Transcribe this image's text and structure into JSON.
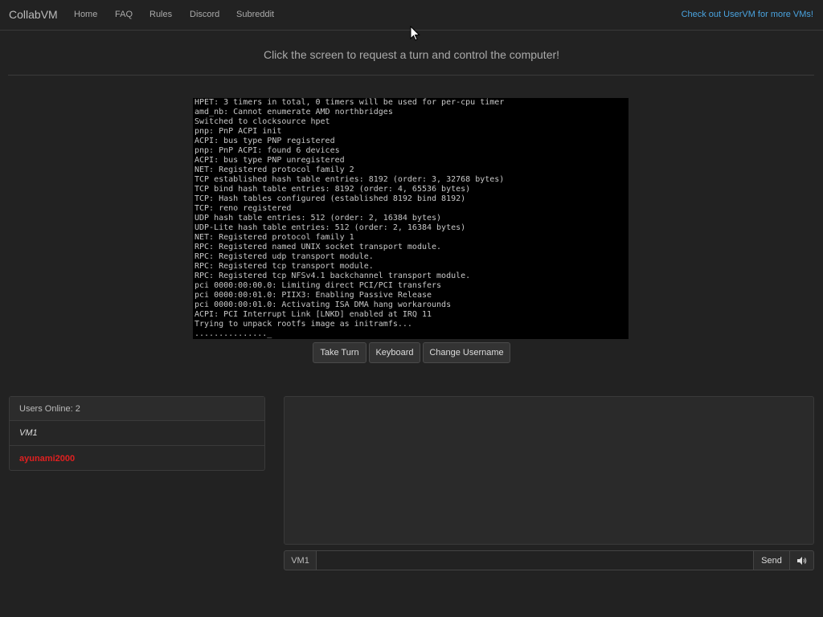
{
  "nav": {
    "brand": "CollabVM",
    "links": [
      "Home",
      "FAQ",
      "Rules",
      "Discord",
      "Subreddit"
    ],
    "promo": "Check out UserVM for more VMs!"
  },
  "prompt": "Click the screen to request a turn and control the computer!",
  "terminal": {
    "lines": [
      "HPET: 3 timers in total, 0 timers will be used for per-cpu timer",
      "amd_nb: Cannot enumerate AMD northbridges",
      "Switched to clocksource hpet",
      "pnp: PnP ACPI init",
      "ACPI: bus type PNP registered",
      "pnp: PnP ACPI: found 6 devices",
      "ACPI: bus type PNP unregistered",
      "NET: Registered protocol family 2",
      "TCP established hash table entries: 8192 (order: 3, 32768 bytes)",
      "TCP bind hash table entries: 8192 (order: 4, 65536 bytes)",
      "TCP: Hash tables configured (established 8192 bind 8192)",
      "TCP: reno registered",
      "UDP hash table entries: 512 (order: 2, 16384 bytes)",
      "UDP-Lite hash table entries: 512 (order: 2, 16384 bytes)",
      "NET: Registered protocol family 1",
      "RPC: Registered named UNIX socket transport module.",
      "RPC: Registered udp transport module.",
      "RPC: Registered tcp transport module.",
      "RPC: Registered tcp NFSv4.1 backchannel transport module.",
      "pci 0000:00:00.0: Limiting direct PCI/PCI transfers",
      "pci 0000:00:01.0: PIIX3: Enabling Passive Release",
      "pci 0000:00:01.0: Activating ISA DMA hang workarounds",
      "ACPI: PCI Interrupt Link [LNKD] enabled at IRQ 11",
      "Trying to unpack rootfs image as initramfs...",
      "..............._"
    ]
  },
  "buttons": {
    "take_turn": "Take Turn",
    "keyboard": "Keyboard",
    "change_username": "Change Username"
  },
  "users": {
    "header": "Users Online: 2",
    "list": [
      {
        "name": "VM1",
        "color": "#dddddd",
        "italic": true
      },
      {
        "name": "ayunami2000",
        "color": "#e02020",
        "italic": false
      }
    ]
  },
  "chat": {
    "username": "VM1",
    "input_value": "",
    "send_label": "Send"
  },
  "icons": {
    "sound": "speaker-icon",
    "cursor": "mouse-cursor-icon"
  }
}
